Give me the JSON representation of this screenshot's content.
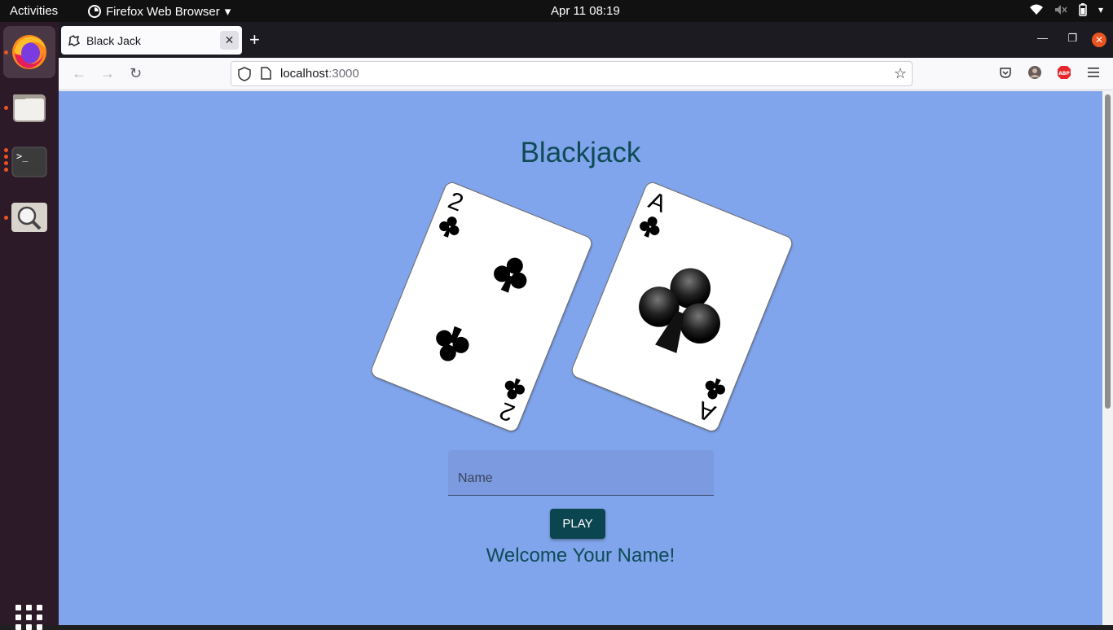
{
  "system": {
    "activities": "Activities",
    "app_name": "Firefox Web Browser",
    "clock": "Apr 11  08:19"
  },
  "browser": {
    "tab_title": "Black Jack",
    "url_host": "localhost",
    "url_port": ":3000"
  },
  "page": {
    "title": "Blackjack",
    "cards": [
      {
        "rank": "2",
        "suit": "clubs"
      },
      {
        "rank": "A",
        "suit": "clubs"
      }
    ],
    "name_input": {
      "placeholder": "Name",
      "value": ""
    },
    "play_button": "PLAY",
    "welcome_text": "Welcome Your Name!"
  },
  "colors": {
    "page_background": "#81a5ec",
    "accent": "#0b4650",
    "title_text": "#0e4b56"
  }
}
